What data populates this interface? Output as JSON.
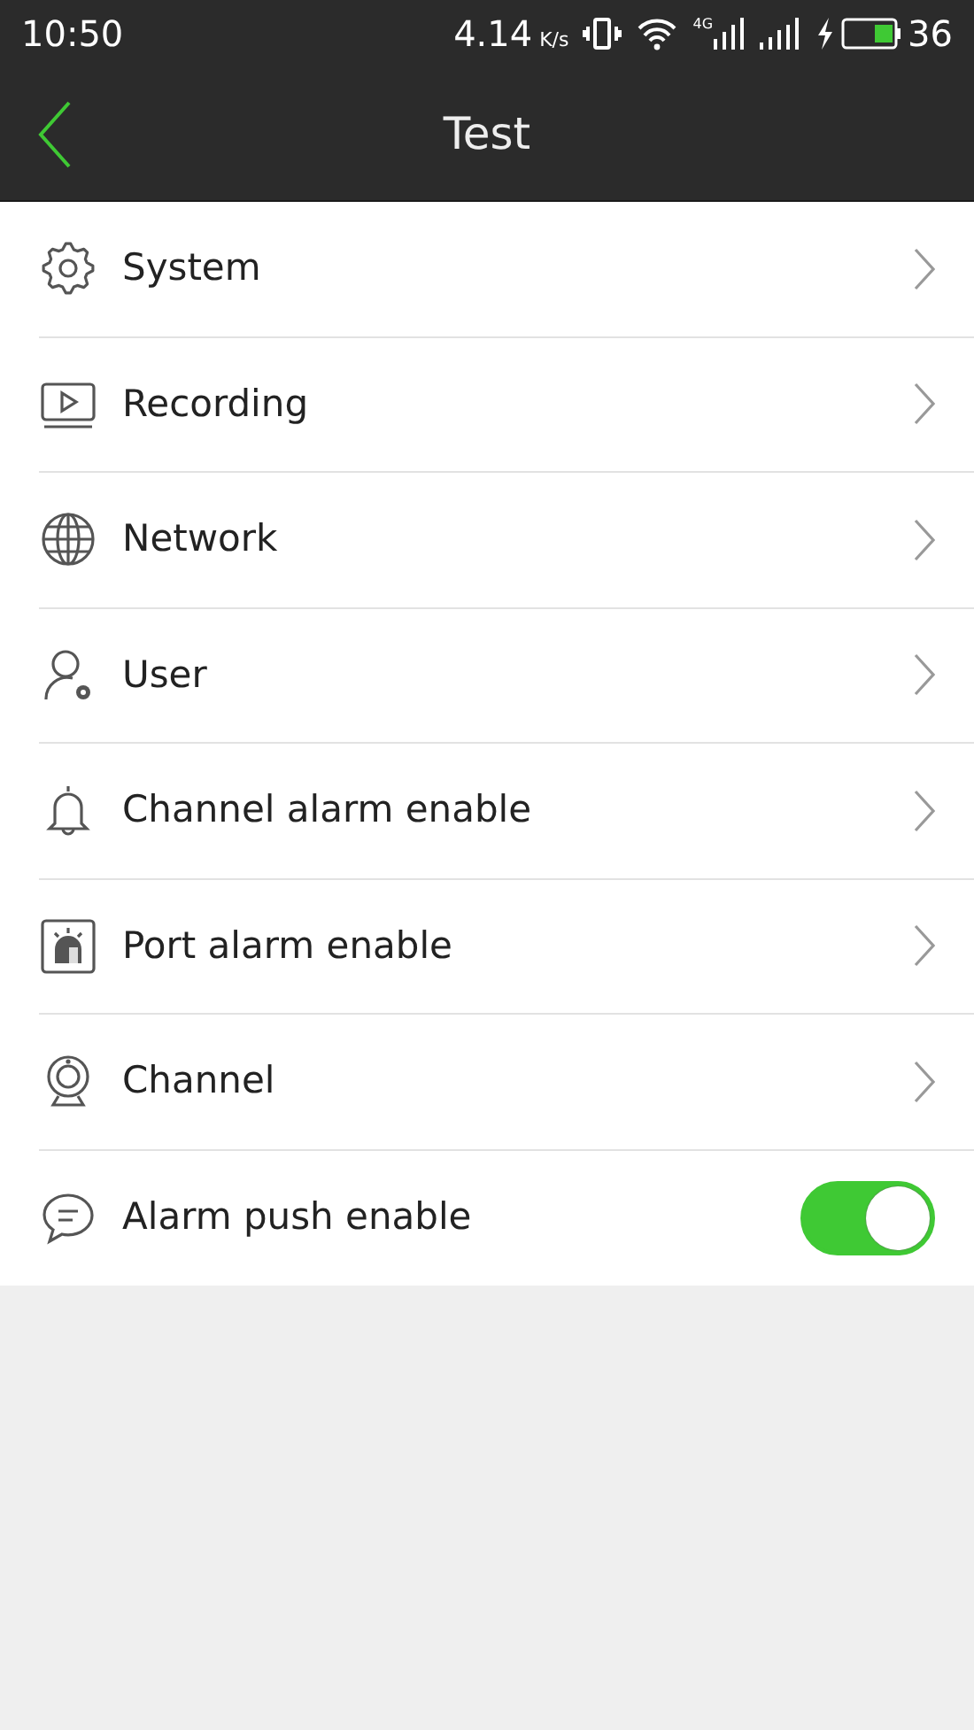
{
  "status_bar": {
    "time": "10:50",
    "speed": "4.14",
    "speed_unit": "K/s",
    "network_type": "4G",
    "battery": "36"
  },
  "header": {
    "title": "Test"
  },
  "items": [
    {
      "kind": "link",
      "label": "System"
    },
    {
      "kind": "link",
      "label": "Recording"
    },
    {
      "kind": "link",
      "label": "Network"
    },
    {
      "kind": "link",
      "label": "User"
    },
    {
      "kind": "link",
      "label": "Channel alarm enable"
    },
    {
      "kind": "link",
      "label": "Port alarm enable"
    },
    {
      "kind": "link",
      "label": "Channel"
    },
    {
      "kind": "toggle",
      "label": "Alarm push enable",
      "on": true
    }
  ]
}
